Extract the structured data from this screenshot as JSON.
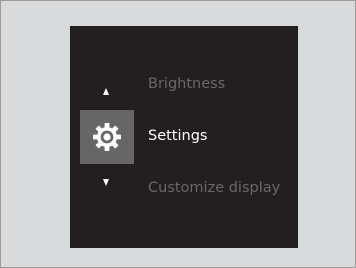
{
  "menu": {
    "previous_item": "Brightness",
    "selected_item": "Settings",
    "next_item": "Customize display"
  },
  "icons": {
    "scroll_up": "up-arrow-icon",
    "selected": "gear-icon",
    "scroll_down": "down-arrow-icon"
  },
  "colors": {
    "screen_background": "#231f20",
    "frame_background": "#d9dadb",
    "selected_text": "#ffffff",
    "unselected_text": "#6b6769",
    "icon_tile": "#676667"
  }
}
